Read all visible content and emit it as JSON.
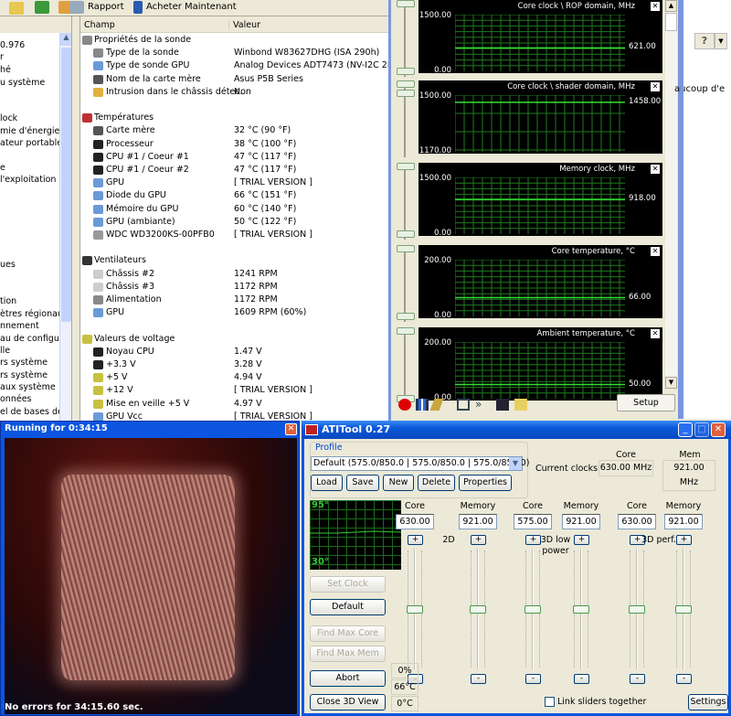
{
  "everest": {
    "toolbar": {
      "report_label": "Rapport",
      "buy_label": "Acheter Maintenant"
    },
    "tree_items": [
      "0.976",
      "r",
      "hé",
      "u système",
      "lock",
      "mie d'énergie",
      "ateur portable",
      "e",
      "l'exploitation",
      "ues",
      "tion",
      "ètres régionaux",
      "nnement",
      "au de configura",
      "lle",
      "rs système",
      "rs système",
      "aux système",
      "onnées",
      "el de bases de d"
    ],
    "columns": {
      "field": "Champ",
      "value": "Valeur"
    },
    "groups": [
      {
        "title": "Propriétés de la sonde",
        "icon": "chip-icon",
        "items": [
          {
            "field": "Type de la sonde",
            "value": "Winbond W83627DHG  (ISA 290h)",
            "icon": "chip-icon"
          },
          {
            "field": "Type de sonde GPU",
            "value": "Analog Devices ADT7473  (NV-I2C 2Eh)",
            "icon": "monitor-icon"
          },
          {
            "field": "Nom de la carte mère",
            "value": "Asus P5B Series",
            "icon": "motherboard-icon"
          },
          {
            "field": "Intrusion dans le châssis détec...",
            "value": "Non",
            "icon": "lock-icon"
          }
        ]
      },
      {
        "title": "Températures",
        "icon": "thermometer-icon",
        "items": [
          {
            "field": "Carte mère",
            "value": "32 °C  (90 °F)",
            "icon": "motherboard-icon"
          },
          {
            "field": "Processeur",
            "value": "38 °C  (100 °F)",
            "icon": "cpu-icon"
          },
          {
            "field": "CPU #1 / Coeur #1",
            "value": "47 °C  (117 °F)",
            "icon": "cpu-icon"
          },
          {
            "field": "CPU #1 / Coeur #2",
            "value": "47 °C  (117 °F)",
            "icon": "cpu-icon"
          },
          {
            "field": "GPU",
            "value": "[ TRIAL VERSION ]",
            "icon": "monitor-icon"
          },
          {
            "field": "Diode du GPU",
            "value": "66 °C  (151 °F)",
            "icon": "monitor-icon"
          },
          {
            "field": "Mémoire du GPU",
            "value": "60 °C  (140 °F)",
            "icon": "monitor-icon"
          },
          {
            "field": "GPU (ambiante)",
            "value": "50 °C  (122 °F)",
            "icon": "monitor-icon"
          },
          {
            "field": "WDC WD3200KS-00PFB0",
            "value": "[ TRIAL VERSION ]",
            "icon": "hdd-icon"
          }
        ]
      },
      {
        "title": "Ventilateurs",
        "icon": "fan-icon",
        "items": [
          {
            "field": "Châssis #2",
            "value": "1241 RPM",
            "icon": "case-icon"
          },
          {
            "field": "Châssis #3",
            "value": "1172 RPM",
            "icon": "case-icon"
          },
          {
            "field": "Alimentation",
            "value": "1172 RPM",
            "icon": "psu-icon"
          },
          {
            "field": "GPU",
            "value": "1609 RPM  (60%)",
            "icon": "monitor-icon"
          }
        ]
      },
      {
        "title": "Valeurs de voltage",
        "icon": "voltage-icon",
        "items": [
          {
            "field": "Noyau CPU",
            "value": "1.47 V",
            "icon": "cpu-icon"
          },
          {
            "field": "+3.3 V",
            "value": "3.28 V",
            "icon": "cpu-icon"
          },
          {
            "field": "+5 V",
            "value": "4.94 V",
            "icon": "voltage-icon"
          },
          {
            "field": "+12 V",
            "value": "[ TRIAL VERSION ]",
            "icon": "voltage-icon"
          },
          {
            "field": "Mise en veille +5 V",
            "value": "4.97 V",
            "icon": "voltage-icon"
          },
          {
            "field": "GPU Vcc",
            "value": "[ TRIAL VERSION ]",
            "icon": "monitor-icon"
          }
        ]
      }
    ]
  },
  "monitor": {
    "graphs": [
      {
        "title": "Core clock \\ ROP domain, MHz",
        "max": "1500.00",
        "min": "0.00",
        "value": "621.00",
        "vmax": 1500,
        "vmin": 0,
        "v": 621
      },
      {
        "title": "Core clock \\ shader domain, MHz",
        "max": "1500.00",
        "min": "1170.00",
        "value": "1458.00",
        "vmax": 1500,
        "vmin": 1170,
        "v": 1458
      },
      {
        "title": "Memory clock, MHz",
        "max": "1500.00",
        "min": "0.00",
        "value": "918.00",
        "vmax": 1500,
        "vmin": 0,
        "v": 918
      },
      {
        "title": "Core temperature, °C",
        "max": "200.00",
        "min": "0.00",
        "value": "66.00",
        "vmax": 200,
        "vmin": 0,
        "v": 66
      },
      {
        "title": "Ambient temperature, °C",
        "max": "200.00",
        "min": "0.00",
        "value": "50.00",
        "vmax": 200,
        "vmin": 0,
        "v": 50
      }
    ],
    "setup_label": "Setup",
    "line_color": "#33dd33"
  },
  "browser": {
    "help_label": "?",
    "text_fragment": "aucoup d'e"
  },
  "stress": {
    "title": "Running for 0:34:15",
    "status": "No errors for 34:15.60 sec."
  },
  "atitool": {
    "title": "ATITool 0.27",
    "profile": {
      "label": "Profile",
      "selected": "Default (575.0/850.0 | 575.0/850.0 | 575.0/850.0)",
      "buttons": [
        "Load",
        "Save",
        "New",
        "Delete",
        "Properties"
      ]
    },
    "current_clocks": {
      "label": "Current clocks:",
      "core_label": "Core",
      "mem_label": "Mem",
      "core": "630.00 MHz",
      "mem": "921.00 MHz"
    },
    "graph": {
      "max": "95°",
      "min": "30°"
    },
    "sections": [
      {
        "label": "2D",
        "core": "630.00",
        "memory": "921.00"
      },
      {
        "label": "3D low power",
        "core": "575.00",
        "memory": "921.00"
      },
      {
        "label": "3D perf.",
        "core": "630.00",
        "memory": "921.00"
      }
    ],
    "core_label": "Core",
    "memory_label": "Memory",
    "buttons": {
      "set_clock": "Set Clock",
      "default": "Default",
      "find_max_core": "Find Max Core",
      "find_max_mem": "Find Max Mem",
      "abort": "Abort",
      "close_3d": "Close 3D View",
      "settings": "Settings"
    },
    "status": {
      "percent": "0%",
      "temp": "66°C",
      "temp2": "0°C"
    },
    "link_sliders": {
      "label": "Link sliders together",
      "checked": false
    }
  }
}
